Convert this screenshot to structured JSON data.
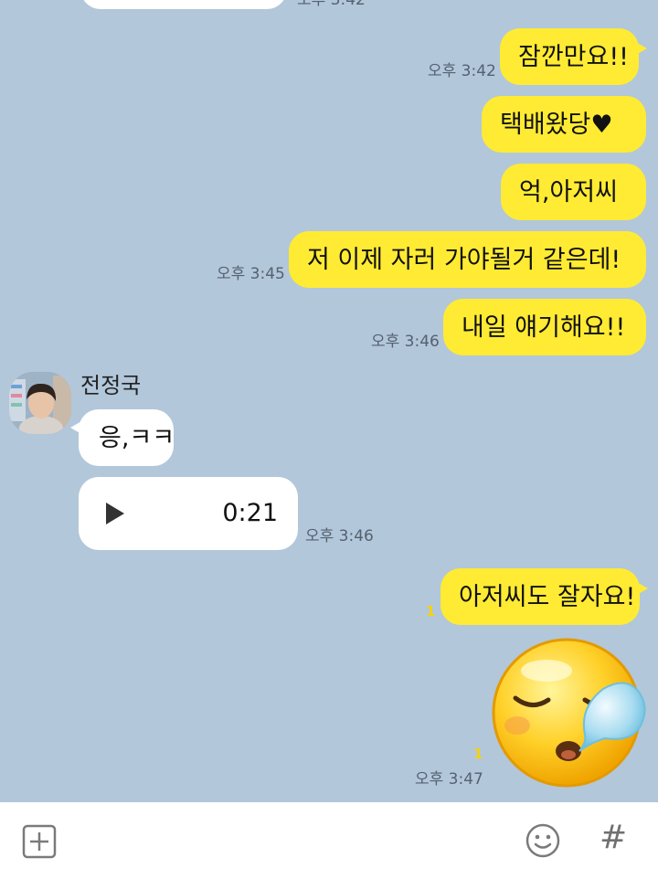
{
  "messages_top": {
    "partial_time": "오후 3:42"
  },
  "outgoing": [
    {
      "text": "잠깐만요!!",
      "time": "오후 3:42"
    },
    {
      "text": "택배왔당♥"
    },
    {
      "text": "억,아저씨"
    },
    {
      "text": "저 이제 자러 가야될거 같은데!",
      "time": "오후 3:45"
    },
    {
      "text": "내일 얘기해요!!",
      "time": "오후 3:46"
    }
  ],
  "incoming": {
    "sender": "전정국",
    "text": "응,ㅋㅋ",
    "voice_duration": "0:21",
    "time": "오후 3:46"
  },
  "outgoing_late": [
    {
      "text": "아저씨도 잘자요!",
      "read_count": "1"
    },
    {
      "sticker": "sleeping-face-emoji",
      "read_count": "1",
      "time": "오후 3:47"
    }
  ],
  "input_bar": {
    "attach_icon": "plus-square-icon",
    "emoji_icon": "smile-icon",
    "hash_label": "#"
  },
  "colors": {
    "background": "#b2c7da",
    "my_bubble": "#ffeb33",
    "their_bubble": "#ffffff"
  }
}
